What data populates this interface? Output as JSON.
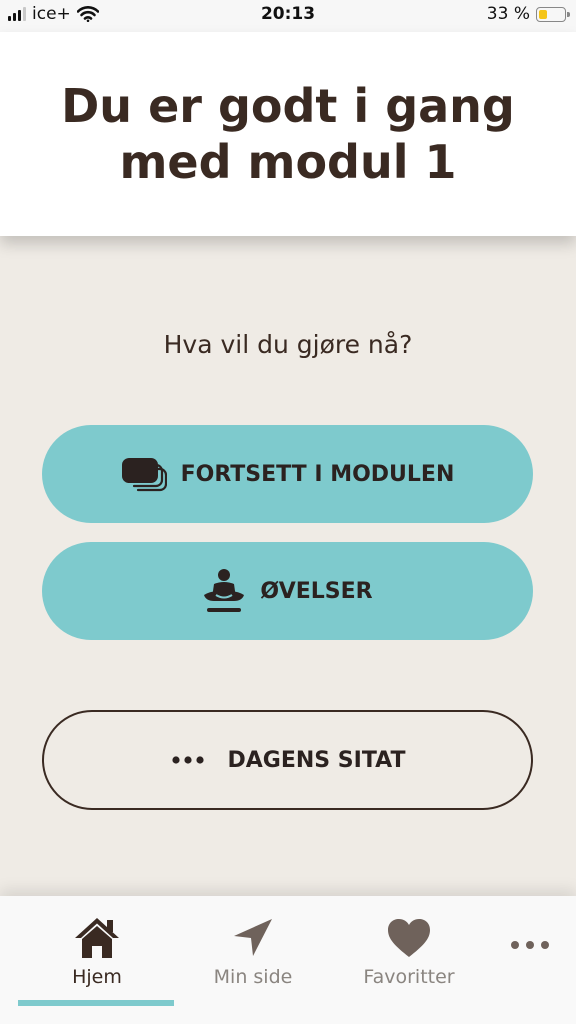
{
  "status_bar": {
    "carrier": "ice+",
    "time": "20:13",
    "battery_percent": "33 %",
    "battery_level": 0.33
  },
  "header": {
    "title": "Du er godt i gang med modul 1"
  },
  "main": {
    "prompt": "Hva vil du gjøre nå?",
    "buttons": [
      {
        "label": "FORTSETT I MODULEN",
        "icon": "cards-icon"
      },
      {
        "label": "ØVELSER",
        "icon": "meditation-icon"
      },
      {
        "label": "DAGENS SITAT",
        "icon": "ellipsis-icon"
      }
    ]
  },
  "nav": {
    "items": [
      {
        "label": "Hjem",
        "icon": "home-icon",
        "active": true
      },
      {
        "label": "Min side",
        "icon": "navigation-arrow-icon",
        "active": false
      },
      {
        "label": "Favoritter",
        "icon": "heart-icon",
        "active": false
      }
    ],
    "more_icon": "more-dots-icon"
  },
  "colors": {
    "accent": "#7ecacd",
    "background": "#efebe5",
    "text": "#3a2a22",
    "inactive": "#8a8580"
  }
}
